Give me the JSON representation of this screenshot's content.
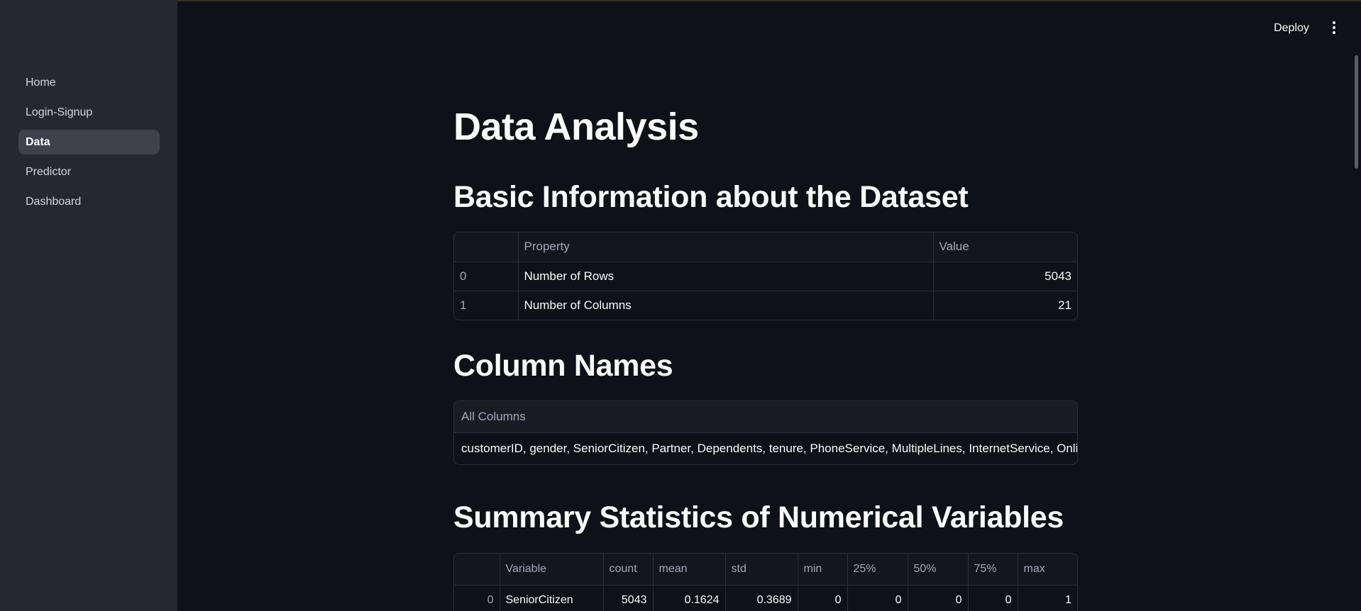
{
  "sidebar": {
    "items": [
      {
        "label": "Home",
        "active": false
      },
      {
        "label": "Login-Signup",
        "active": false
      },
      {
        "label": "Data",
        "active": true
      },
      {
        "label": "Predictor",
        "active": false
      },
      {
        "label": "Dashboard",
        "active": false
      }
    ]
  },
  "header": {
    "deploy_label": "Deploy",
    "menu_icon": "kebab-menu-icon"
  },
  "main": {
    "title": "Data Analysis",
    "basic_info": {
      "heading": "Basic Information about the Dataset",
      "columns": [
        "",
        "Property",
        "Value"
      ],
      "rows": [
        {
          "index": "0",
          "property": "Number of Rows",
          "value": "5043"
        },
        {
          "index": "1",
          "property": "Number of Columns",
          "value": "21"
        }
      ]
    },
    "column_names": {
      "heading": "Column Names",
      "header": "All Columns",
      "value": "customerID, gender, SeniorCitizen, Partner, Dependents, tenure, PhoneService, MultipleLines, InternetService, OnlineSe"
    },
    "summary": {
      "heading": "Summary Statistics of Numerical Variables",
      "columns": [
        "",
        "Variable",
        "count",
        "mean",
        "std",
        "min",
        "25%",
        "50%",
        "75%",
        "max"
      ],
      "rows": [
        {
          "index": "0",
          "variable": "SeniorCitizen",
          "count": "5043",
          "mean": "0.1624",
          "std": "0.3689",
          "min": "0",
          "p25": "0",
          "p50": "0",
          "p75": "0",
          "max": "1"
        }
      ]
    }
  },
  "colors": {
    "background": "#0e1117",
    "sidebar": "#262730",
    "active_nav": "#3f414d",
    "border": "#2d2f38"
  }
}
